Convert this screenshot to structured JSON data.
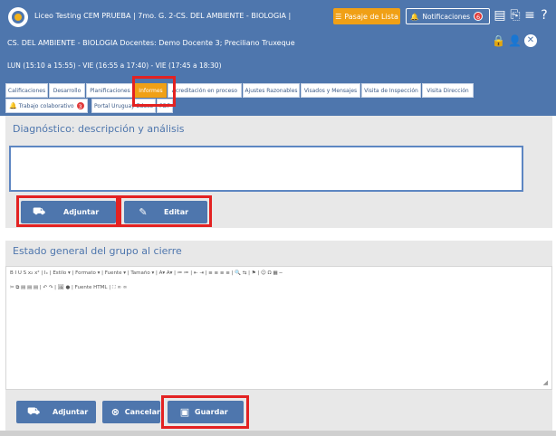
{
  "header": {
    "course_line": "Liceo Testing CEM PRUEBA | 7mo. G. 2-CS. DEL AMBIENTE - BIOLOGIA |",
    "docentes_line": "CS. DEL AMBIENTE - BIOLOGIA Docentes: Demo Docente 3; Preciliano Truxeque",
    "schedule_line": "LUN (15:10 a 15:55) - VIE (16:55 a 17:40) - VIE (17:45 a 18:30)",
    "pasaje_label": "Pasaje de Lista",
    "notificaciones_label": "Notificaciones",
    "notificaciones_count": "6"
  },
  "tabs": [
    {
      "label": "Calificaciones"
    },
    {
      "label": "Desarrollo"
    },
    {
      "label": "Planificaciones"
    },
    {
      "label": "Informes"
    },
    {
      "label": "Acreditación en proceso"
    },
    {
      "label": "Ajustes Razonables"
    },
    {
      "label": "Visados y Mensajes"
    },
    {
      "label": "Visita de Inspección"
    },
    {
      "label": "Visita Dirección"
    },
    {
      "label": "Trabajo colaborativo"
    },
    {
      "label": "Portal Uruguay Educa"
    },
    {
      "label": "PDF"
    }
  ],
  "trabajo_badge": "3",
  "diagnostico": {
    "title": "Diagnóstico: descripción y análisis",
    "adjuntar_label": "Adjuntar",
    "editar_label": "Editar"
  },
  "estado": {
    "title": "Estado general del grupo al cierre",
    "toolbar_row1": "B  I  U  S  x₂  x²  |  Iₓ  |  Estilo  ▾  |  Formato  ▾  |  Fuente  ▾  |  Tamaño  ▾  |  A▾  A▾  |  ≔  ≔  |  ⇤  ⇥  |  ≡  ≡  ≡  ≡  |  🔍  ⇆  |  ⚑  |  ☺  Ω  ▦  ─",
    "toolbar_row2": "✂  ⧉  ▤  ▤  ▤  |  ↶  ↷  |  🖼  ●  |  Fuente HTML  |  ⛶  ∞  ∞",
    "adjuntar_label": "Adjuntar",
    "cancelar_label": "Cancelar",
    "guardar_label": "Guardar"
  }
}
